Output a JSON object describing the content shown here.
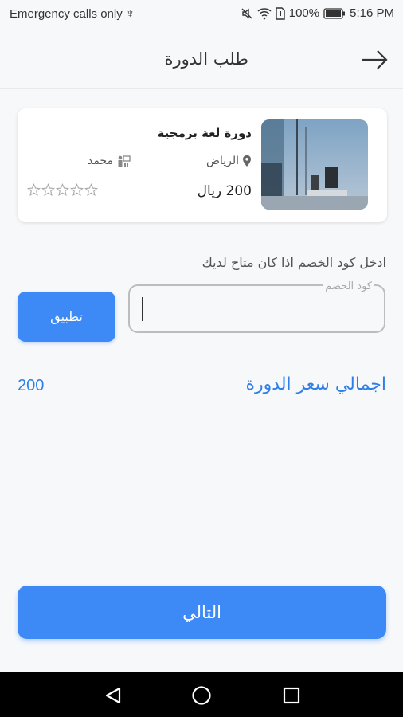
{
  "status_bar": {
    "carrier": "Emergency calls only",
    "battery": "100%",
    "time": "5:16 PM"
  },
  "header": {
    "title": "طلب الدورة",
    "back_icon": "arrow-right-icon"
  },
  "course": {
    "name": "دورة لغة برمجية",
    "location": "الرياض",
    "trainer": "محمد",
    "price": "200 ريال",
    "rating": 0,
    "rating_max": 5
  },
  "discount": {
    "hint": "ادخل كود الخصم اذا كان متاح لديك",
    "field_label": "كود الخصم",
    "value": "",
    "apply_label": "تطبيق"
  },
  "total": {
    "label": "اجمالي سعر الدورة",
    "value": "200"
  },
  "footer": {
    "next_label": "التالي"
  },
  "colors": {
    "accent": "#3d8af7",
    "total_text": "#2f7fe8",
    "background": "#f7f8fa"
  }
}
